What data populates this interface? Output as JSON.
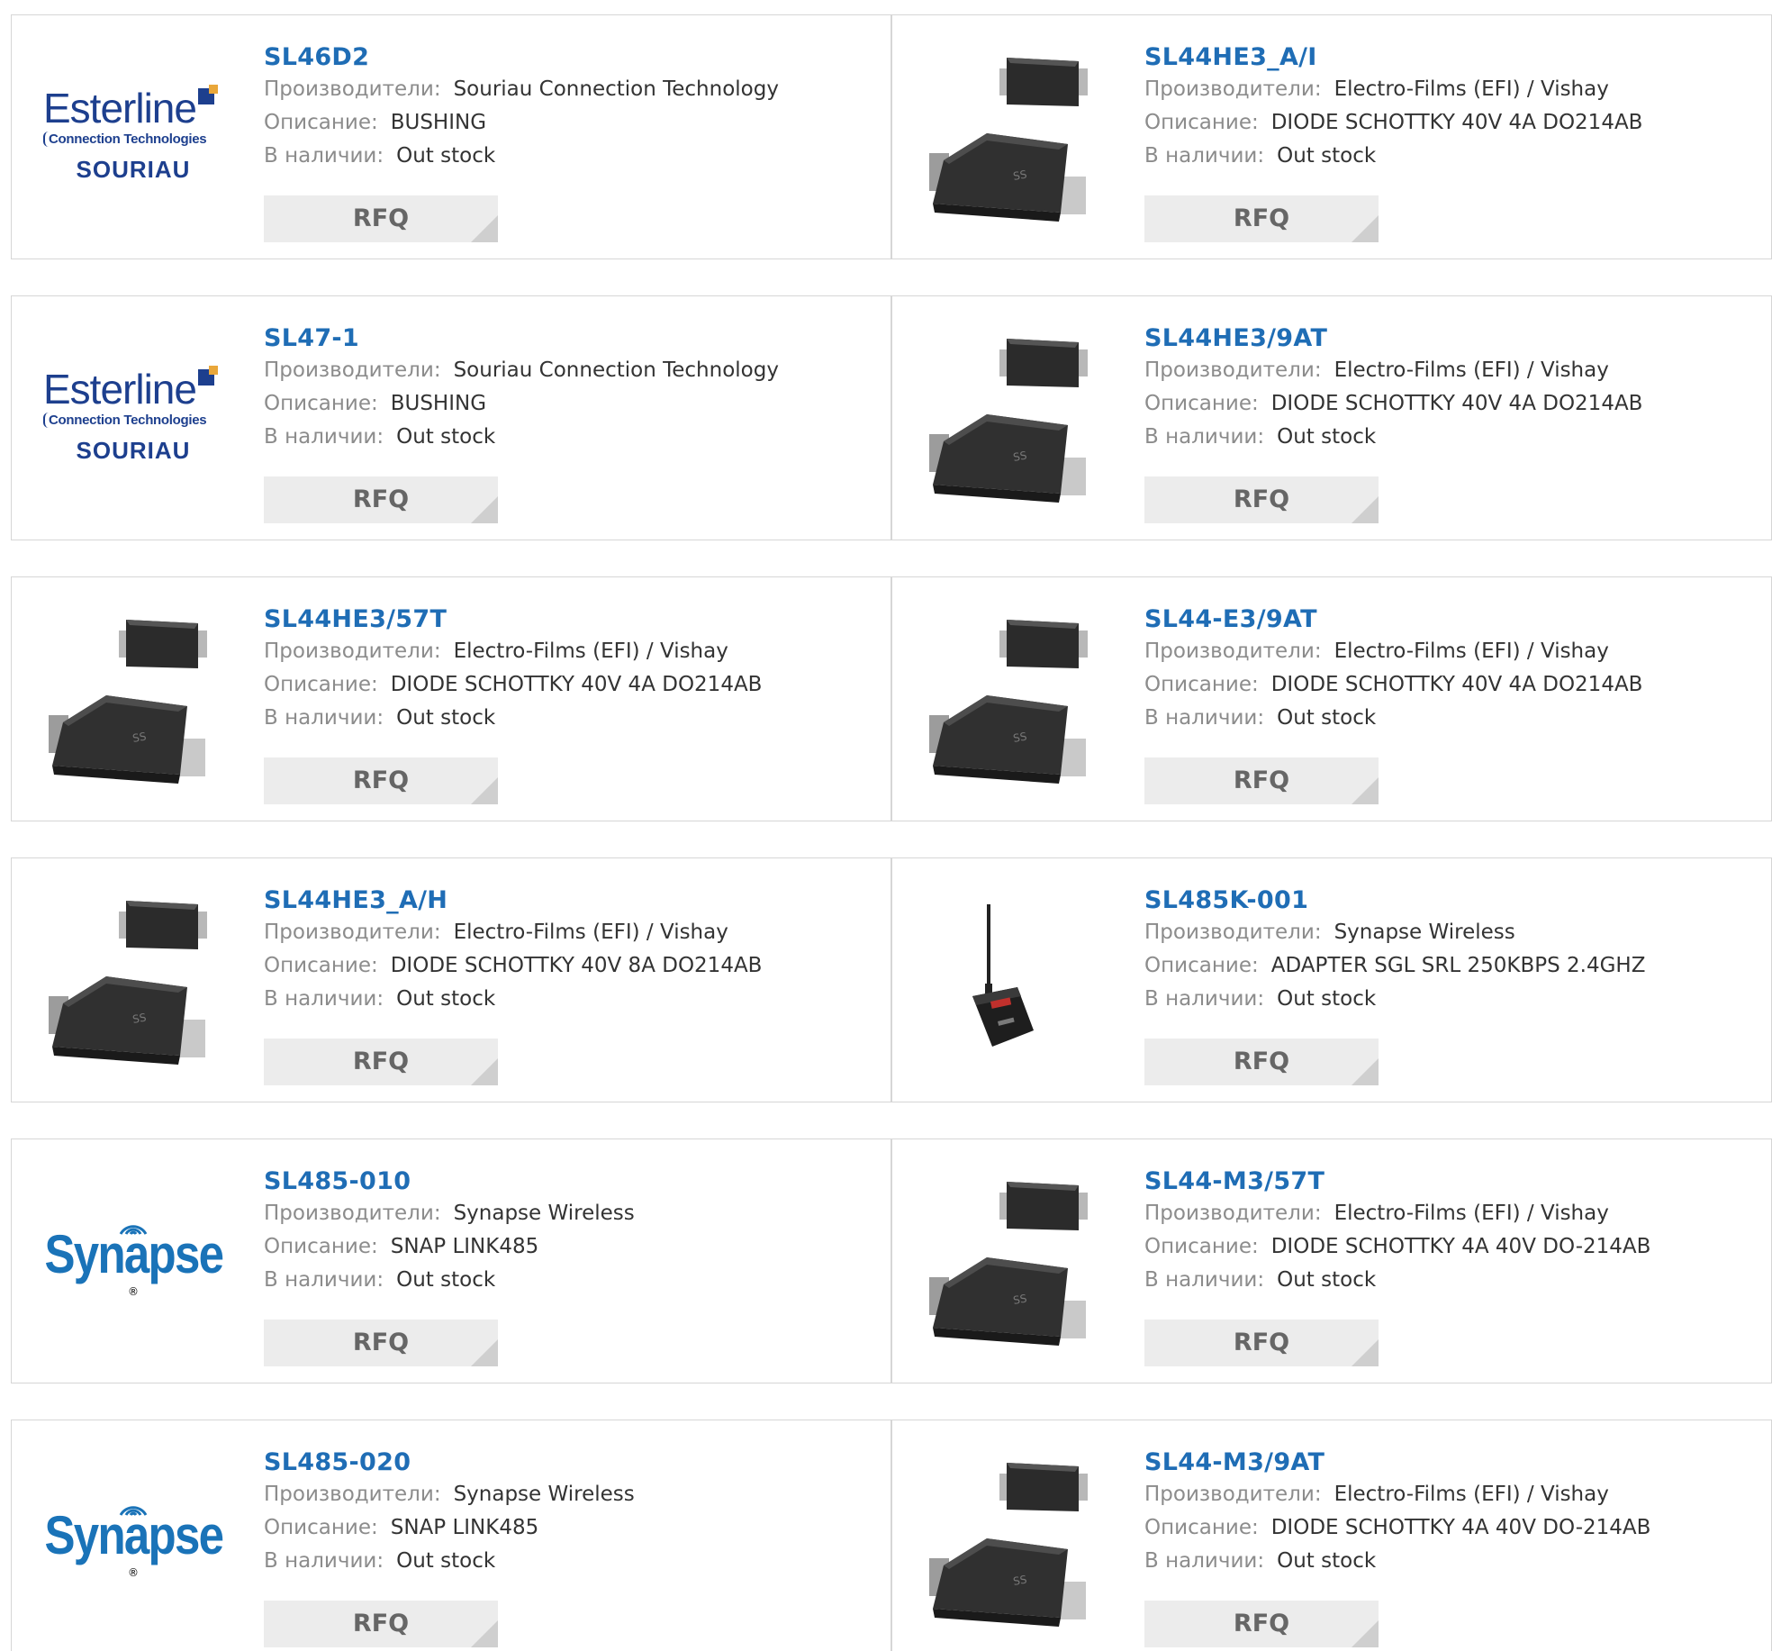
{
  "labels": {
    "manufacturer": "Производители:",
    "description": "Описание:",
    "stock": "В наличии:",
    "rfq": "RFQ"
  },
  "colors": {
    "title": "#1f6db5",
    "label": "#8c8c8c",
    "border": "#d6d6d6",
    "rfq_bg": "#ececec"
  },
  "logos": {
    "esterline_word": "Esterline",
    "esterline_sub": "Connection Technologies",
    "esterline_brand": "SOURIAU",
    "synapse_word": "Synapse"
  },
  "products": [
    {
      "title": "SL46D2",
      "manufacturer": "Souriau Connection Technology",
      "description": "BUSHING",
      "stock": "Out stock",
      "image": "esterline-logo"
    },
    {
      "title": "SL44HE3_A/I",
      "manufacturer": "Electro-Films (EFI) / Vishay",
      "description": "DIODE SCHOTTKY 40V 4A DO214AB",
      "stock": "Out stock",
      "image": "diode-image"
    },
    {
      "title": "SL47-1",
      "manufacturer": "Souriau Connection Technology",
      "description": "BUSHING",
      "stock": "Out stock",
      "image": "esterline-logo"
    },
    {
      "title": "SL44HE3/9AT",
      "manufacturer": "Electro-Films (EFI) / Vishay",
      "description": "DIODE SCHOTTKY 40V 4A DO214AB",
      "stock": "Out stock",
      "image": "diode-image"
    },
    {
      "title": "SL44HE3/57T",
      "manufacturer": "Electro-Films (EFI) / Vishay",
      "description": "DIODE SCHOTTKY 40V 4A DO214AB",
      "stock": "Out stock",
      "image": "diode-image"
    },
    {
      "title": "SL44-E3/9AT",
      "manufacturer": "Electro-Films (EFI) / Vishay",
      "description": "DIODE SCHOTTKY 40V 4A DO214AB",
      "stock": "Out stock",
      "image": "diode-image"
    },
    {
      "title": "SL44HE3_A/H",
      "manufacturer": "Electro-Films (EFI) / Vishay",
      "description": "DIODE SCHOTTKY 40V 8A DO214AB",
      "stock": "Out stock",
      "image": "diode-image"
    },
    {
      "title": "SL485K-001",
      "manufacturer": "Synapse Wireless",
      "description": "ADAPTER SGL SRL 250KBPS 2.4GHZ",
      "stock": "Out stock",
      "image": "adapter-image"
    },
    {
      "title": "SL485-010",
      "manufacturer": "Synapse Wireless",
      "description": "SNAP LINK485",
      "stock": "Out stock",
      "image": "synapse-logo"
    },
    {
      "title": "SL44-M3/57T",
      "manufacturer": "Electro-Films (EFI) / Vishay",
      "description": "DIODE SCHOTTKY 4A 40V DO-214AB",
      "stock": "Out stock",
      "image": "diode-image"
    },
    {
      "title": "SL485-020",
      "manufacturer": "Synapse Wireless",
      "description": "SNAP LINK485",
      "stock": "Out stock",
      "image": "synapse-logo"
    },
    {
      "title": "SL44-M3/9AT",
      "manufacturer": "Electro-Films (EFI) / Vishay",
      "description": "DIODE SCHOTTKY 4A 40V DO-214AB",
      "stock": "Out stock",
      "image": "diode-image"
    }
  ]
}
